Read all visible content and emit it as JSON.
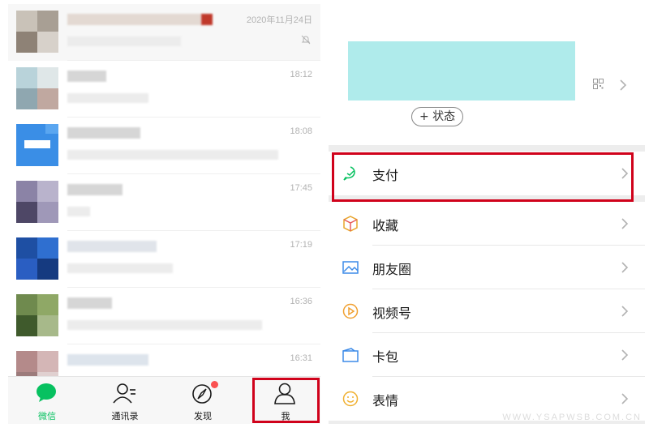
{
  "chat_list": {
    "rows": [
      {
        "time": "2020年11月24日",
        "muted": true
      },
      {
        "time": "18:12"
      },
      {
        "time": "18:08"
      },
      {
        "time": "17:45"
      },
      {
        "time": "17:19"
      },
      {
        "time": "16:36"
      },
      {
        "time": "16:31"
      }
    ]
  },
  "tabbar": {
    "tabs": [
      {
        "label": "微信",
        "icon": "chat-bubble-icon",
        "active": true
      },
      {
        "label": "通讯录",
        "icon": "contacts-icon"
      },
      {
        "label": "发现",
        "icon": "compass-icon",
        "badge": true
      },
      {
        "label": "我",
        "icon": "person-icon",
        "highlighted": true
      }
    ]
  },
  "me_page": {
    "status_button": "+ 状态",
    "menu": [
      {
        "label": "支付",
        "icon": "pay-icon",
        "highlighted": true
      },
      {
        "label": "收藏",
        "icon": "favorites-cube-icon"
      },
      {
        "label": "朋友圈",
        "icon": "moments-image-icon"
      },
      {
        "label": "视频号",
        "icon": "channels-play-icon"
      },
      {
        "label": "卡包",
        "icon": "card-wallet-icon"
      },
      {
        "label": "表情",
        "icon": "sticker-smile-icon"
      }
    ],
    "watermark": "WWW.YSAPWSB.COM.CN"
  },
  "colors": {
    "accent_green": "#07c160",
    "highlight_red": "#d0021b",
    "profile_cyan": "#afebeb",
    "badge_red": "#fa5151"
  }
}
